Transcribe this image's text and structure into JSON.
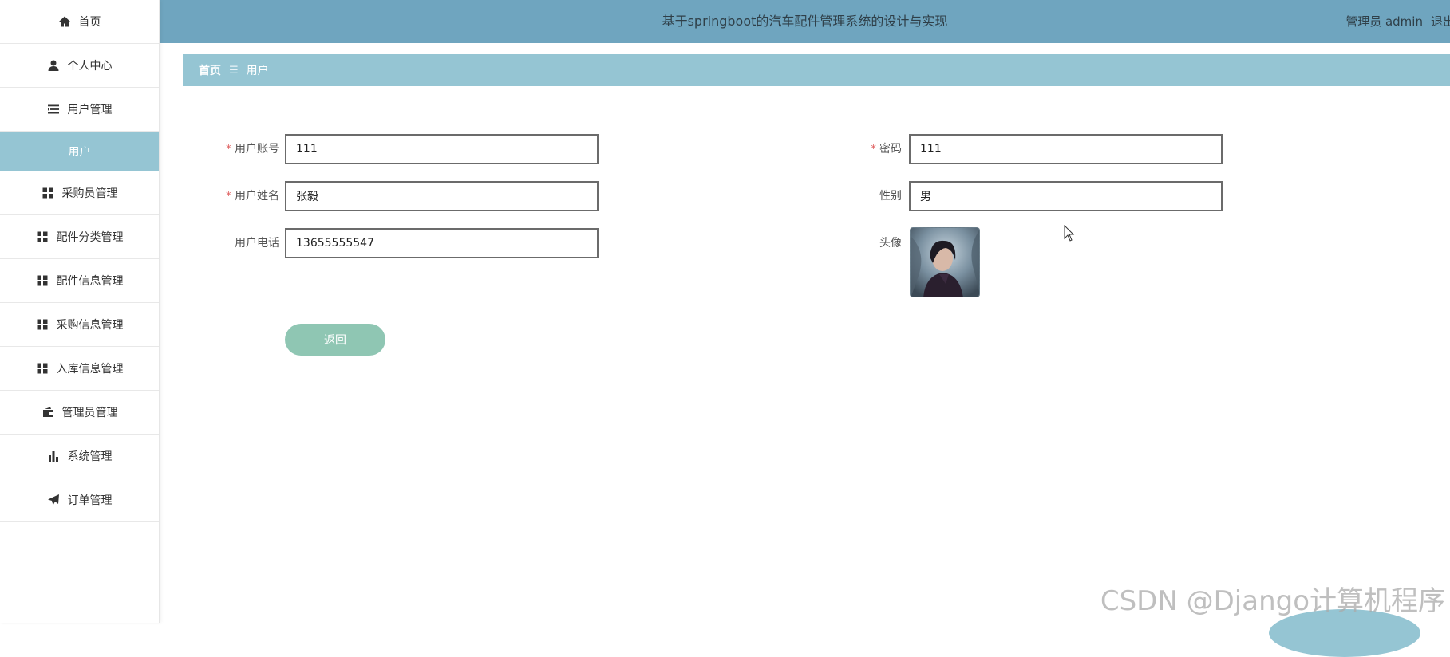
{
  "sidebar": {
    "items": [
      {
        "label": "首页",
        "icon": "home-icon"
      },
      {
        "label": "个人中心",
        "icon": "person-icon"
      },
      {
        "label": "用户管理",
        "icon": "list-icon"
      },
      {
        "label": "用户",
        "icon": ""
      },
      {
        "label": "采购员管理",
        "icon": "grid-icon"
      },
      {
        "label": "配件分类管理",
        "icon": "grid-icon"
      },
      {
        "label": "配件信息管理",
        "icon": "grid-icon"
      },
      {
        "label": "采购信息管理",
        "icon": "grid-icon"
      },
      {
        "label": "入库信息管理",
        "icon": "grid-icon"
      },
      {
        "label": "管理员管理",
        "icon": "wallet-icon"
      },
      {
        "label": "系统管理",
        "icon": "bar-chart-icon"
      },
      {
        "label": "订单管理",
        "icon": "send-icon"
      }
    ]
  },
  "header": {
    "title": "基于springboot的汽车配件管理系统的设计与实现",
    "role": "管理员 admin",
    "logout": "退出"
  },
  "breadcrumb": {
    "home": "首页",
    "separator": "☰",
    "current": "用户"
  },
  "form": {
    "account_label": "用户账号",
    "account_value": "111",
    "password_label": "密码",
    "password_value": "111",
    "name_label": "用户姓名",
    "name_value": "张毅",
    "gender_label": "性别",
    "gender_value": "男",
    "phone_label": "用户电话",
    "phone_value": "13655555547",
    "avatar_label": "头像",
    "required_mark": "*"
  },
  "actions": {
    "back_label": "返回"
  },
  "watermark": "CSDN @Django计算机程序",
  "colors": {
    "header_bg": "#6fa5bf",
    "accent": "#95c5d3",
    "button": "#8fc6b3",
    "required": "#e06464"
  }
}
